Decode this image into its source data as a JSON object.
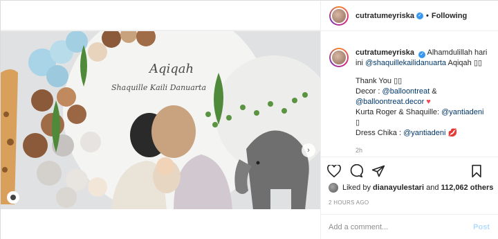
{
  "header": {
    "username": "cutratumeyriska",
    "separator": "•",
    "follow_label": "Following"
  },
  "caption": {
    "username": "cutratumeyriska",
    "line1": "Alhamdulillah hari ini",
    "mention1": "@shaquillekailidanuarta",
    "line1b": "Aqiqah",
    "thanks": "Thank You",
    "decor_label": "Decor :",
    "decor_m1": "@balloontreat",
    "amp": "&",
    "decor_m2": "@balloontreat.decor",
    "kurta_label": "Kurta Roger & Shaquille:",
    "kurta_m": "@yantiadeni",
    "dress_label": "Dress Chika :",
    "dress_m": "@yantiadeni",
    "time": "2h"
  },
  "media": {
    "banner_title": "Aqiqah",
    "banner_name": "Shaquille Kaili Danuarta"
  },
  "likes": {
    "prefix": "Liked by",
    "user": "dianayulestari",
    "and": "and",
    "count": "112,062 others"
  },
  "post_time": "2 HOURS AGO",
  "add_comment": {
    "placeholder": "Add a comment...",
    "post_label": "Post"
  },
  "colors": {
    "link": "#00376b",
    "verified": "#3897f0",
    "muted": "#8e8e8e",
    "post_disabled": "#b3dbff"
  }
}
